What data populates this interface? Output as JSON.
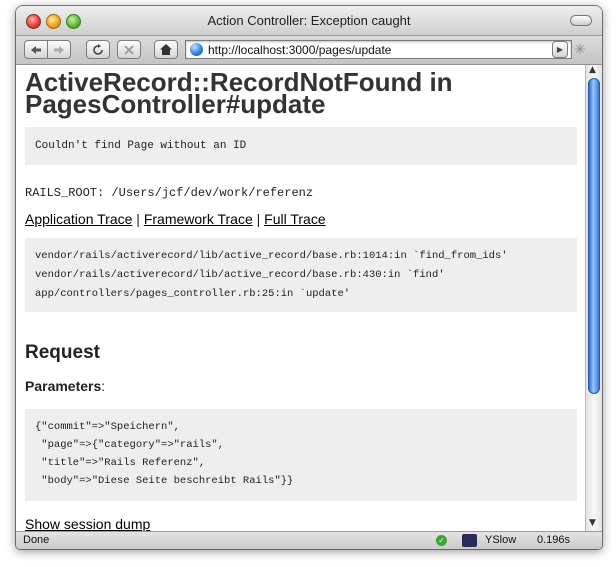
{
  "window": {
    "title": "Action Controller: Exception caught"
  },
  "toolbar": {
    "back_icon": "back-arrow-icon",
    "forward_icon": "forward-arrow-icon",
    "reload_icon": "reload-icon",
    "stop_icon": "stop-icon",
    "home_icon": "home-icon",
    "url": "http://localhost:3000/pages/update"
  },
  "page": {
    "heading": "ActiveRecord::RecordNotFound in PagesController#update",
    "message": "Couldn't find Page without an ID",
    "rails_root": "RAILS_ROOT: /Users/jcf/dev/work/referenz",
    "trace_links": [
      {
        "label": "Application Trace"
      },
      {
        "label": "Framework Trace"
      },
      {
        "label": "Full Trace"
      }
    ],
    "separator": "|",
    "trace": [
      "vendor/rails/activerecord/lib/active_record/base.rb:1014:in `find_from_ids'",
      "vendor/rails/activerecord/lib/active_record/base.rb:430:in `find'",
      "app/controllers/pages_controller.rb:25:in `update'"
    ],
    "request_heading": "Request",
    "parameters_label": "Parameters",
    "parameters_colon": ":",
    "parameters": [
      "{\"commit\"=>\"Speichern\",",
      " \"page\"=>{\"category\"=>\"rails\",",
      " \"title\"=>\"Rails Referenz\",",
      " \"body\"=>\"Diese Seite beschreibt Rails\"}}"
    ],
    "session_link": "Show session dump"
  },
  "status": {
    "text": "Done",
    "yslow_label": "YSlow",
    "load_time": "0.196s",
    "ok_color": "#3aa43a"
  }
}
